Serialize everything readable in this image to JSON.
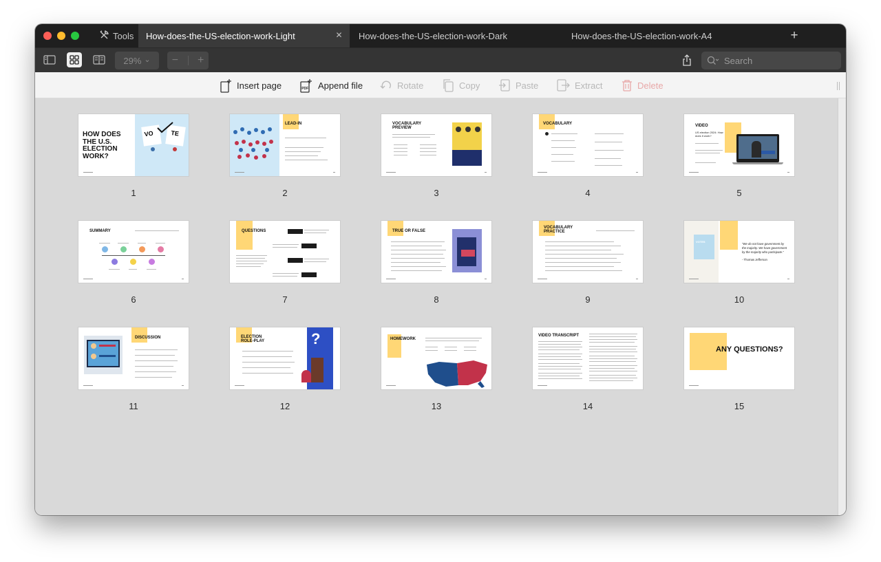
{
  "tabbar": {
    "tools_label": "Tools",
    "tabs": [
      {
        "label": "How-does-the-US-election-work-Light",
        "active": true
      },
      {
        "label": "How-does-the-US-election-work-Dark",
        "active": false
      },
      {
        "label": "How-does-the-US-election-work-A4",
        "active": false
      }
    ],
    "close_glyph": "✕",
    "new_tab_glyph": "+"
  },
  "toolbar": {
    "zoom": "29%",
    "zoom_chevron": "⌄",
    "zoom_out": "−",
    "zoom_in": "+",
    "search_placeholder": "Search"
  },
  "pagebar": {
    "insert_page": "Insert page",
    "append_file": "Append file",
    "rotate": "Rotate",
    "copy": "Copy",
    "paste": "Paste",
    "extract": "Extract",
    "delete": "Delete"
  },
  "pages": [
    {
      "number": "1",
      "title": "HOW DOES THE U.S. ELECTION WORK?",
      "vote_left": "VO",
      "vote_right": "TE"
    },
    {
      "number": "2",
      "title": "LEAD-IN"
    },
    {
      "number": "3",
      "title": "VOCABULARY PREVIEW"
    },
    {
      "number": "4",
      "title": "VOCABULARY"
    },
    {
      "number": "5",
      "title": "VIDEO",
      "subtitle": "US election 2024: How does it work?"
    },
    {
      "number": "6",
      "title": "SUMMARY"
    },
    {
      "number": "7",
      "title": "QUESTIONS"
    },
    {
      "number": "8",
      "title": "TRUE OR FALSE"
    },
    {
      "number": "9",
      "title": "VOCABULARY PRACTICE"
    },
    {
      "number": "10",
      "quote": "“We do not have government by the majority. We have government by the majority who participate.”",
      "author": "- Thomas Jefferson",
      "box_label": "VOTES"
    },
    {
      "number": "11",
      "title": "DISCUSSION"
    },
    {
      "number": "12",
      "title": "ELECTION ROLE-PLAY",
      "mark": "?"
    },
    {
      "number": "13",
      "title": "HOMEWORK"
    },
    {
      "number": "14",
      "title": "VIDEO TRANSCRIPT"
    },
    {
      "number": "15",
      "title": "ANY QUESTIONS?"
    }
  ],
  "colors": {
    "accent_yellow": "#ffd776",
    "map_blue": "#1f4e8c",
    "map_red": "#c2324a",
    "sky_blue": "#cfe8f7"
  }
}
